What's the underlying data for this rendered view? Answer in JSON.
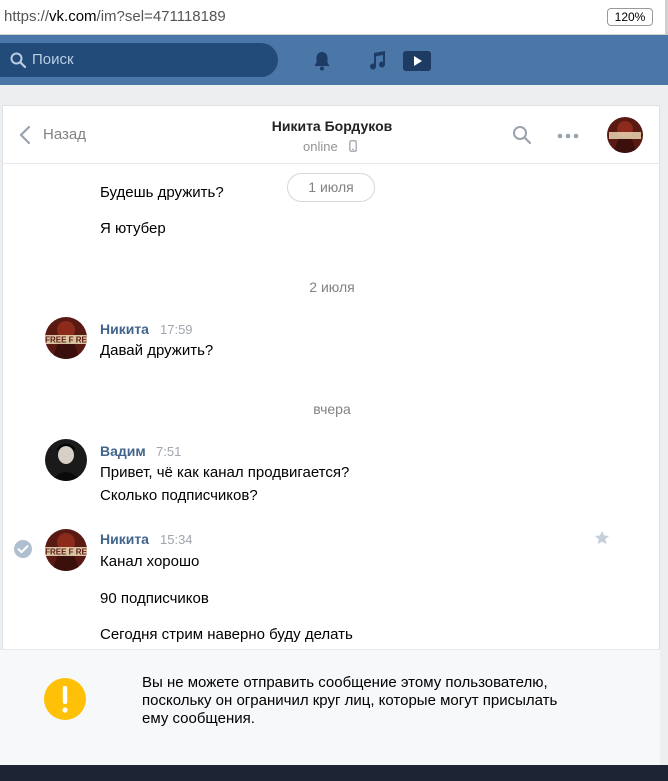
{
  "browser": {
    "url_prefix": "https://",
    "url_host": "vk.com",
    "url_path": "/im?sel=471118189",
    "zoom": "120%"
  },
  "header": {
    "search_placeholder": "Поиск",
    "icons": [
      "search-icon",
      "bell-icon",
      "music-note-icon",
      "video-play-icon"
    ],
    "color": "#4a76a8"
  },
  "chat": {
    "back_label": "Назад",
    "peer_name": "Никита Бордуков",
    "peer_status": "online",
    "icons": [
      "chevron-left-icon",
      "phone-icon",
      "search-icon",
      "more-icon"
    ]
  },
  "messages": {
    "early": [
      "Будешь дружить?",
      "Я ютубер"
    ],
    "date_pill": "1 июля",
    "date2": "2 июля",
    "m1_author": "Никита",
    "m1_time": "17:59",
    "m1_text": "Давай дружить?",
    "date3": "вчера",
    "m2_author": "Вадим",
    "m2_time": "7:51",
    "m2_lines": [
      "Привет, чё как канал продвигается?",
      "Сколько подписчиков?"
    ],
    "m3_author": "Никита",
    "m3_time": "15:34",
    "m3_lines": [
      "Канал хорошо",
      "90 подписчиков",
      "Сегодня стрим наверно буду делать"
    ],
    "avatar_logo_text": "FREE F RE"
  },
  "notice": {
    "lines": [
      "Вы не можете отправить сообщение этому пользователю,",
      "поскольку он ограничил круг лиц, которые могут присылать",
      "ему сообщения."
    ],
    "icon": "exclamation-icon",
    "icon_color": "#ffc107"
  }
}
